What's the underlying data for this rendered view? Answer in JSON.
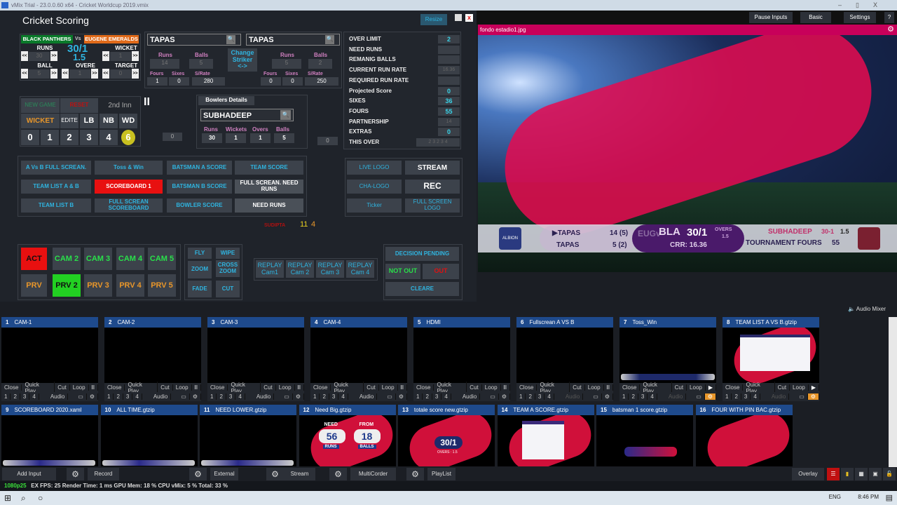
{
  "window": {
    "title": "vMix Trial - 23.0.0.60 x64 - Cricket Worldcup 2019.vmix",
    "controls": [
      "–",
      "▯",
      "X"
    ]
  },
  "top_buttons": [
    "Pause Inputs",
    "Basic",
    "Settings",
    "?"
  ],
  "scoring": {
    "title": "Cricket Scoring",
    "resize": "Resize",
    "team_a": "BLACK PANTHERS",
    "vs": "Vs",
    "team_b": "EUGENE EMERALDS",
    "score": "30/1",
    "overs": "1.5",
    "runs_label": "RUNS",
    "runs": "30",
    "wicket_label": "WICKET",
    "wicket": "1",
    "ball_label": "BALL",
    "ball": "5",
    "overe_label": "OVERE",
    "overe": "1",
    "target_label": "TARGET",
    "target": "0",
    "dec": "<<",
    "inc": ">>",
    "batsman1": {
      "name": "TAPAS",
      "runs": "14",
      "balls": "5",
      "fours": "1",
      "sixes": "0",
      "srate": "280"
    },
    "batsman2": {
      "name": "TAPAS",
      "runs": "5",
      "balls": "2",
      "fours": "0",
      "sixes": "0",
      "srate": "250"
    },
    "bat_labels": {
      "runs": "Runs",
      "balls": "Balls",
      "fours": "Fours",
      "sixes": "Sixes",
      "srate": "S/Rate"
    },
    "change_striker": [
      "Change",
      "Striker",
      "<->"
    ],
    "stats": [
      {
        "label": "OVER LIMIT",
        "value": "2"
      },
      {
        "label": "NEED RUNS",
        "value": ""
      },
      {
        "label": "REMANIG BALLS",
        "value": ""
      },
      {
        "label": "CURRENT RUN RATE",
        "value": "16.36"
      },
      {
        "label": "REQUIRED RUN RATE",
        "value": ""
      },
      {
        "label": "Projected Score",
        "value": "0"
      },
      {
        "label": "SIXES",
        "value": "36"
      },
      {
        "label": "FOURS",
        "value": "55"
      },
      {
        "label": "PARTNERSHIP",
        "value": "14"
      },
      {
        "label": "EXTRAS",
        "value": "0"
      },
      {
        "label": "THIS OVER",
        "value": "2 3 2 3 4"
      }
    ],
    "controls": {
      "new_game": "NEW GAME",
      "reset": "RESET",
      "inn": "2nd Inn",
      "wicket": "WICKET",
      "edite": "EDITE",
      "lb": "LB",
      "nb": "NB",
      "wd": "WD",
      "runs": [
        "0",
        "1",
        "2",
        "3",
        "4",
        "6"
      ]
    },
    "pause": "II",
    "box_a": "0",
    "box_b": "0",
    "bowler": {
      "header": "Bowlers Details",
      "name": "SUBHADEEP",
      "labels": [
        "Runs",
        "Wickets",
        "Overs",
        "Balls"
      ],
      "values": [
        "30",
        "1",
        "1",
        "5"
      ]
    },
    "graphics": [
      "A Vs  B  FULL SCREAN.",
      "Toss & Win",
      "BATSMAN A SCORE",
      "TEAM SCORE",
      "TEAM LIST A & B",
      "SCOREBOARD 1",
      "BATSMAN B SCORE",
      "FULL SCREAN. NEED RUNS",
      "TEAM LIST B",
      "FULL SCREAN SCOREBOARD",
      "BOWLER SCORE",
      "NEED RUNS"
    ],
    "logos": [
      "LIVE LOGO",
      "STREAM",
      "CHA-LOGO",
      "REC",
      "Ticker",
      "FULL SCREEN LOGO"
    ],
    "sudipta": "SUDIPTA",
    "num1": "11",
    "num2": "4",
    "cams": [
      "ACT",
      "CAM 2",
      "CAM 3",
      "CAM 4",
      "CAM 5",
      "PRV",
      "PRV 2",
      "PRV 3",
      "PRV 4",
      "PRV 5"
    ],
    "transitions": [
      "FLY",
      "WIPE",
      "ZOOM",
      "CROSS ZOOM",
      "FADE",
      "CUT"
    ],
    "replays": [
      "REPLAY Cam1",
      "REPLAY Cam 2",
      "REPLAY Cam 3",
      "REPLAY Cam 4"
    ],
    "decision": {
      "pending": "DECISION PENDING",
      "not_out": "NOT OUT",
      "out": "OUT",
      "clear": "CLEARE"
    }
  },
  "preview": {
    "title": "fondo estadio1.jpg",
    "lower_third": {
      "bat1": "TAPAS",
      "bat1_score": "14 (5)",
      "bat2": "TAPAS",
      "bat2_score": "5 (2)",
      "teams_a": "EUGv",
      "team": "BLA",
      "score": "30/1",
      "overs_label": "OVERS",
      "overs": "1.5",
      "crr": "CRR: 16.36",
      "bowler": "SUBHADEEP",
      "bowler_fig": "30-1",
      "bowler_overs": "1.5",
      "ticker": "TOURNAMENT FOURS",
      "ticker_val": "55",
      "logo_left": "ALBION"
    }
  },
  "audio_mixer": "Audio Mixer",
  "tile_controls": {
    "close": "Close",
    "quick": "Quick Play",
    "cut": "Cut",
    "loop": "Loop",
    "audio": "Audio",
    "nums": [
      "1",
      "2",
      "3",
      "4"
    ]
  },
  "inputs_row1": [
    {
      "n": "1",
      "name": "CAM-1"
    },
    {
      "n": "2",
      "name": "CAM-2"
    },
    {
      "n": "3",
      "name": "CAM-3"
    },
    {
      "n": "4",
      "name": "CAM-4"
    },
    {
      "n": "5",
      "name": "HDMI"
    },
    {
      "n": "6",
      "name": "Fullscrean A VS B"
    },
    {
      "n": "7",
      "name": "Toss_Win"
    },
    {
      "n": "8",
      "name": "TEAM LIST A VS B.gtzip"
    }
  ],
  "inputs_row2": [
    {
      "n": "9",
      "name": "SCOREBOARD 2020.xaml"
    },
    {
      "n": "10",
      "name": "ALL TIME.gtzip"
    },
    {
      "n": "11",
      "name": "NEED LOWER.gtzip"
    },
    {
      "n": "12",
      "name": "Need Big.gtzip"
    },
    {
      "n": "13",
      "name": "totale score new.gtzip"
    },
    {
      "n": "14",
      "name": "TEAM A SCORE.gtzip"
    },
    {
      "n": "15",
      "name": "batsman 1 score.gtzip"
    },
    {
      "n": "16",
      "name": "FOUR WITH PIN BAC.gtzip"
    }
  ],
  "need_big": {
    "need": "NEED",
    "from": "FROM",
    "runs_val": "56",
    "balls_val": "18",
    "runs": "RUNS",
    "balls": "BALLS"
  },
  "total_score": {
    "score": "30/1",
    "overs": "OVERS : 1.5"
  },
  "toolbar": {
    "add_input": "Add Input",
    "record": "Record",
    "external": "External",
    "stream": "Stream",
    "multicorder": "MultiCorder",
    "playlist": "PlayList",
    "overlay": "Overlay"
  },
  "status": {
    "format": "1080p25",
    "text": "EX  FPS: 25  Render Time: 1 ms  GPU Mem: 18 %  CPU vMix: 5 %  Total: 33 %"
  },
  "taskbar": {
    "lang": "ENG",
    "time": "8:46 PM"
  },
  "colors": {
    "accent_blue": "#1e4a8c",
    "preview_header": "#c8005a",
    "active_red": "#e01010",
    "preview_green": "#22d022",
    "cyan": "#2fb4e0"
  }
}
